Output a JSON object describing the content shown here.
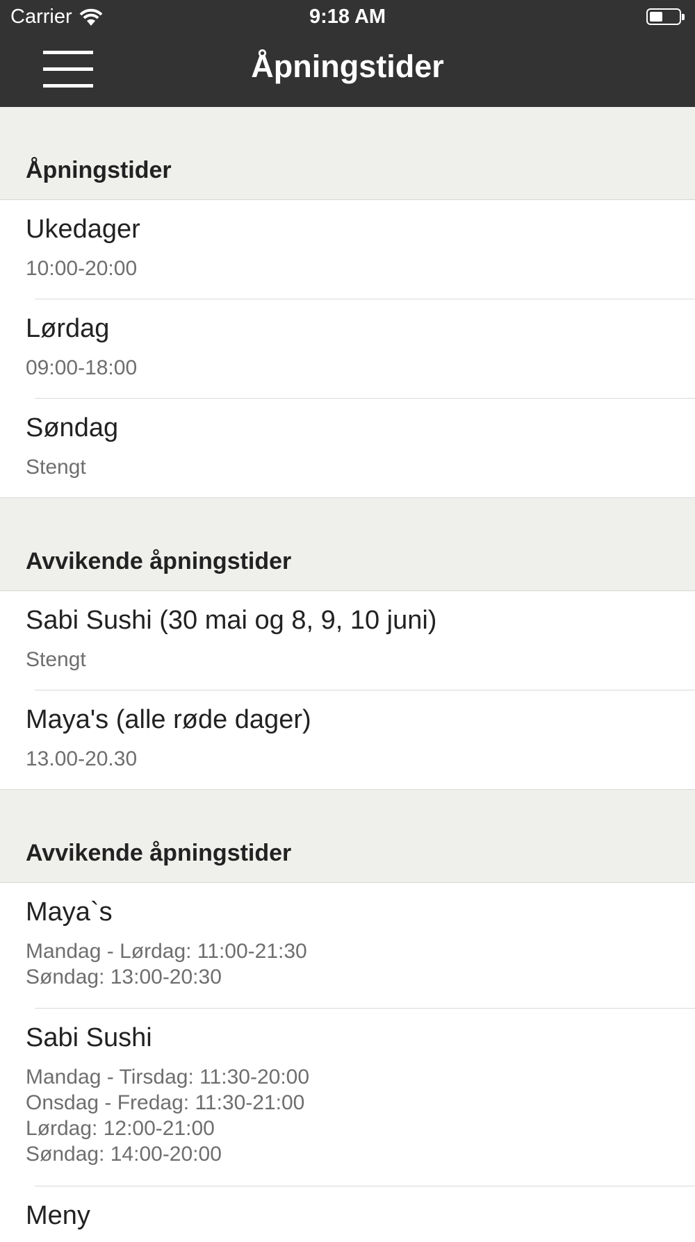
{
  "status_bar": {
    "carrier": "Carrier",
    "time": "9:18 AM"
  },
  "nav": {
    "title": "Åpningstider",
    "menu_icon": "hamburger-menu-icon"
  },
  "sections": [
    {
      "header": "Åpningstider",
      "rows": [
        {
          "title": "Ukedager",
          "detail": "10:00-20:00"
        },
        {
          "title": "Lørdag",
          "detail": "09:00-18:00"
        },
        {
          "title": "Søndag",
          "detail": "Stengt"
        }
      ]
    },
    {
      "header": "Avvikende åpningstider",
      "rows": [
        {
          "title": "Sabi Sushi (30 mai og 8, 9, 10 juni)",
          "detail": "Stengt"
        },
        {
          "title": "Maya's (alle røde dager)",
          "detail": "13.00-20.30"
        }
      ]
    },
    {
      "header": "Avvikende åpningstider",
      "rows": [
        {
          "title": "Maya`s",
          "detail_lines": [
            "Mandag - Lørdag: 11:00-21:30",
            "Søndag: 13:00-20:30"
          ]
        },
        {
          "title": "Sabi Sushi",
          "detail_lines": [
            "Mandag - Tirsdag: 11:30-20:00",
            "Onsdag - Fredag: 11:30-21:00",
            "Lørdag: 12:00-21:00",
            "Søndag: 14:00-20:00"
          ]
        },
        {
          "title": "Meny"
        }
      ]
    }
  ]
}
